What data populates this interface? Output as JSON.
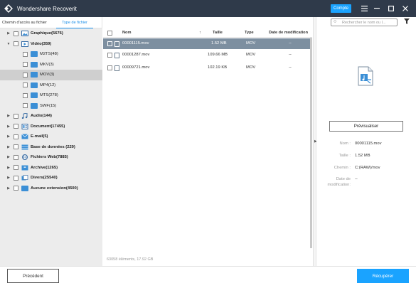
{
  "window": {
    "title": "Wondershare Recoverit",
    "account_label": "Compte",
    "menu_icon": "hamburger-menu-icon",
    "min_icon": "minimize-icon",
    "max_icon": "maximize-icon",
    "close_icon": "close-icon"
  },
  "left_tabs": [
    {
      "label": "Chemin d'accès au fichier"
    },
    {
      "label": "Type de fichier"
    }
  ],
  "tree": {
    "items": [
      {
        "label": "Graphique(5676)"
      },
      {
        "label": "Vidéo(359)"
      },
      {
        "label": "M2TS(48)"
      },
      {
        "label": "MKV(3)"
      },
      {
        "label": "MOV(3)"
      },
      {
        "label": "MP4(12)"
      },
      {
        "label": "MTS(278)"
      },
      {
        "label": "SWF(15)"
      },
      {
        "label": "Audio(144)"
      },
      {
        "label": "Document(17455)"
      },
      {
        "label": "E-mail(5)"
      },
      {
        "label": "Base de données (229)"
      },
      {
        "label": "Fichiers Web(7885)"
      },
      {
        "label": "Archive(1265)"
      },
      {
        "label": "Divers(25540)"
      },
      {
        "label": "Aucune extension(4500)"
      }
    ]
  },
  "table": {
    "headers": {
      "name": "Nom",
      "size": "Taille",
      "type": "Type",
      "modified": "Date de modification"
    },
    "rows": [
      {
        "name": "00001115.mov",
        "size": "1.52 MB",
        "type": "MOV",
        "modified": "--"
      },
      {
        "name": "00001287.mov",
        "size": "109.66 MB",
        "type": "MOV",
        "modified": "--"
      },
      {
        "name": "00009721.mov",
        "size": "102.19 KB",
        "type": "MOV",
        "modified": "--"
      }
    ]
  },
  "status_text": "63058 éléments, 17.92 GB",
  "search": {
    "placeholder": "Rechercher le nom ou l..."
  },
  "preview": {
    "button_label": "Prévisualiser",
    "name_label": "Nom :",
    "name_value": "00001115.mov",
    "size_label": "Taille :",
    "size_value": "1.52 MB",
    "path_label": "Chemin :",
    "path_value": "C:(RAW)/mov",
    "date_label_1": "Date de",
    "date_label_2": "modification:",
    "date_value": "--"
  },
  "footer": {
    "prev_label": "Précédent",
    "recover_label": "Récupérer"
  },
  "colors": {
    "titlebar": "#2f3a4a",
    "accent": "#1aa3ff",
    "selected_row": "#7d8fa0"
  }
}
